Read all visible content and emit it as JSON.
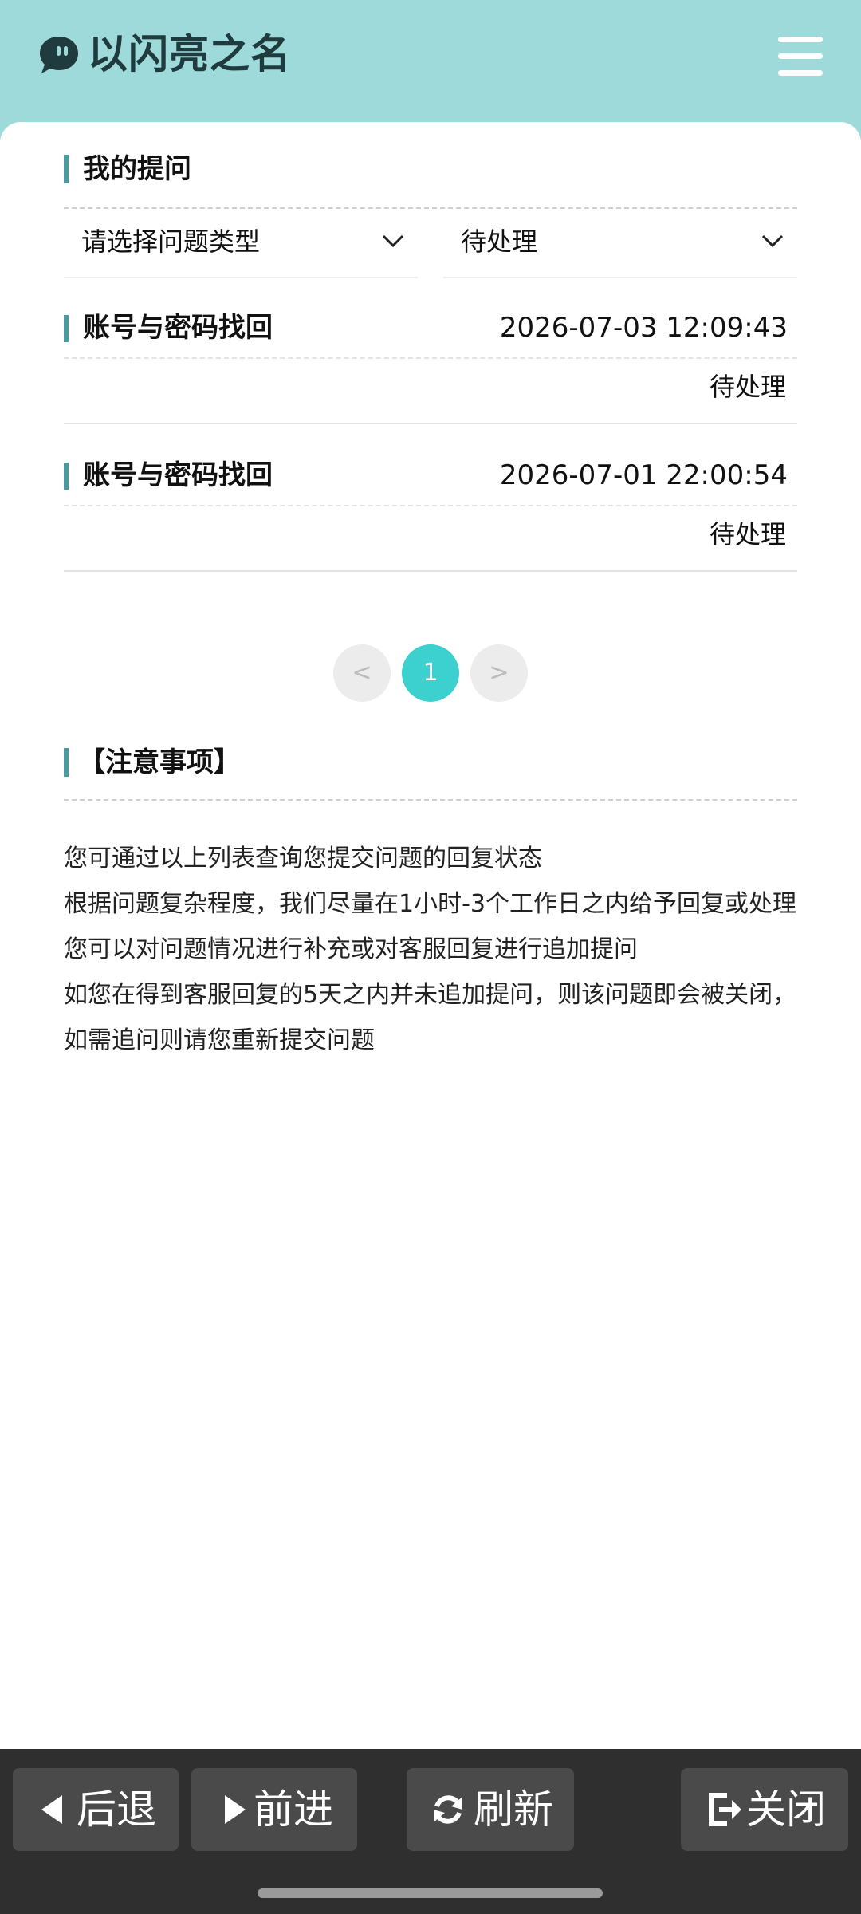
{
  "app": {
    "title": "以闪亮之名",
    "logo_icon": "chat-bubble-icon",
    "menu_icon": "hamburger-icon"
  },
  "questions": {
    "title": "我的提问",
    "filters": {
      "type_placeholder": "请选择问题类型",
      "status_selected": "待处理"
    },
    "items": [
      {
        "title": "账号与密码找回",
        "time": "2026-07-03 12:09:43",
        "status": "待处理"
      },
      {
        "title": "账号与密码找回",
        "time": "2026-07-01 22:00:54",
        "status": "待处理"
      }
    ],
    "pagination": {
      "prev": "<",
      "current": "1",
      "next": ">"
    }
  },
  "notes": {
    "title": "【注意事项】",
    "lines": [
      "您可通过以上列表查询您提交问题的回复状态",
      "根据问题复杂程度，我们尽量在1小时-3个工作日之内给予回复或处理",
      "您可以对问题情况进行补充或对客服回复进行追加提问",
      "如您在得到客服回复的5天之内并未追加提问，则该问题即会被关闭，如需追问则请您重新提交问题"
    ]
  },
  "toolbar": {
    "back": "后退",
    "forward": "前进",
    "refresh": "刷新",
    "close": "关闭"
  },
  "colors": {
    "header_bg": "#9fdadb",
    "accent_bar": "#4a9aa0",
    "page_active": "#3cd0ce",
    "toolbar_bg": "#2f2f2f"
  }
}
